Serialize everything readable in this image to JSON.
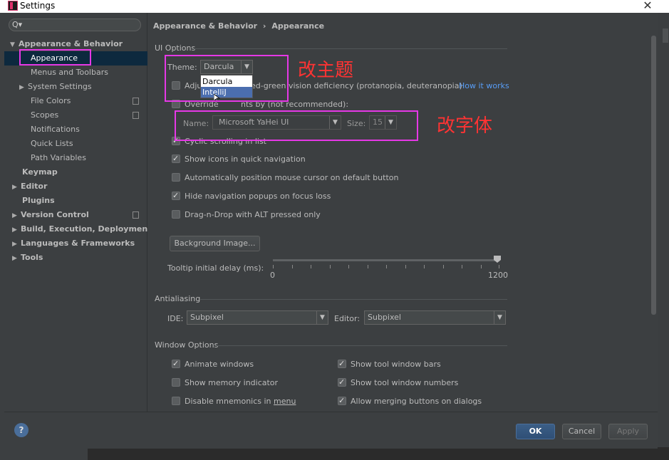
{
  "window": {
    "title": "Settings",
    "close": "✕"
  },
  "search": {
    "icon": "search-icon"
  },
  "sidebar": {
    "items": [
      {
        "label": "Appearance & Behavior",
        "arrow": "▼"
      },
      {
        "label": "Appearance"
      },
      {
        "label": "Menus and Toolbars"
      },
      {
        "label": "System Settings",
        "arrow": "▶"
      },
      {
        "label": "File Colors"
      },
      {
        "label": "Scopes"
      },
      {
        "label": "Notifications"
      },
      {
        "label": "Quick Lists"
      },
      {
        "label": "Path Variables"
      },
      {
        "label": "Keymap"
      },
      {
        "label": "Editor",
        "arrow": "▶"
      },
      {
        "label": "Plugins"
      },
      {
        "label": "Version Control",
        "arrow": "▶"
      },
      {
        "label": "Build, Execution, Deployment",
        "arrow": "▶"
      },
      {
        "label": "Languages & Frameworks",
        "arrow": "▶"
      },
      {
        "label": "Tools",
        "arrow": "▶"
      }
    ]
  },
  "breadcrumb": {
    "parent": "Appearance & Behavior",
    "sep": "›",
    "current": "Appearance"
  },
  "ui_options": {
    "title": "UI Options",
    "theme_label": "Theme:",
    "theme_value": "Darcula",
    "theme_options": [
      "Darcula",
      "IntelliJ"
    ],
    "adjust_colors_prefix": "Adju",
    "adjust_colors_suffix": "ed-green vision deficiency (protanopia, deuteranopia)",
    "how_it_works": "How it works",
    "override_fonts_prefix": "Override",
    "override_fonts_suffix": "nts by (not recommended):",
    "font_name_label": "Name:",
    "font_name_value": "Microsoft YaHei UI",
    "font_size_label": "Size:",
    "font_size_value": "15",
    "cyclic_scrolling": "Cyclic scrolling in list",
    "show_icons": "Show icons in quick navigation",
    "auto_position": "Automatically position mouse cursor on default button",
    "hide_popups": "Hide navigation popups on focus loss",
    "drag_drop": "Drag-n-Drop with ALT pressed only",
    "background_image": "Background Image...",
    "tooltip_label": "Tooltip initial delay (ms):",
    "slider_min": "0",
    "slider_max": "1200"
  },
  "antialiasing": {
    "title": "Antialiasing",
    "ide_label": "IDE:",
    "ide_value": "Subpixel",
    "editor_label": "Editor:",
    "editor_value": "Subpixel"
  },
  "window_options": {
    "title": "Window Options",
    "animate": "Animate windows",
    "memory": "Show memory indicator",
    "mnemonics_prefix": "Disable mnemonics in ",
    "mnemonics_underlined": "menu",
    "tool_bars": "Show tool window bars",
    "tool_numbers": "Show tool window numbers",
    "merging": "Allow merging buttons on dialogs"
  },
  "footer": {
    "help": "?",
    "ok": "OK",
    "cancel": "Cancel",
    "apply": "Apply"
  },
  "annotations": {
    "theme_note": "改主题",
    "font_note": "改字体"
  },
  "colors": {
    "annotation": "#e638e6",
    "annotation_text": "#ff3333",
    "selection": "#0d293e",
    "link": "#589df6"
  }
}
